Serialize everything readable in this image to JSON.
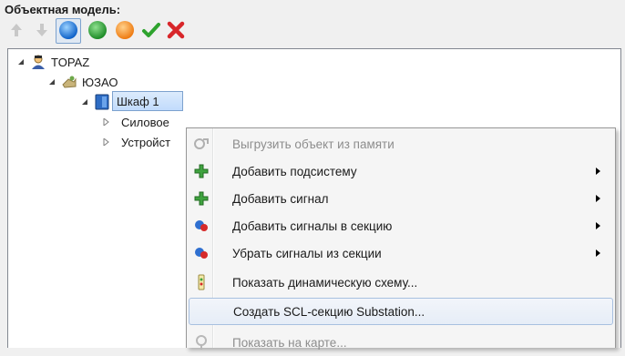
{
  "panel": {
    "title": "Объектная модель:"
  },
  "toolbar": {
    "buttons": [
      {
        "icon": "arrow-up-icon",
        "enabled": false
      },
      {
        "icon": "arrow-down-icon",
        "enabled": false
      },
      {
        "icon": "blue-circle-icon",
        "pressed": true
      },
      {
        "icon": "green-circle-icon"
      },
      {
        "icon": "orange-circle-icon"
      },
      {
        "icon": "checkmark-icon"
      },
      {
        "icon": "red-x-icon"
      }
    ]
  },
  "tree": {
    "nodes": [
      {
        "label": "TOPAZ",
        "icon": "user-icon",
        "expanded": true
      },
      {
        "label": "ЮЗАО",
        "icon": "substation-icon",
        "expanded": true
      },
      {
        "label": "Шкаф 1",
        "icon": "cabinet-icon",
        "expanded": true,
        "selected": true
      },
      {
        "label": "Силовое",
        "expanded": false
      },
      {
        "label": "Устройст",
        "expanded": false
      }
    ]
  },
  "context_menu": {
    "items": [
      {
        "label": "Выгрузить объект из памяти",
        "icon": "unload-icon",
        "disabled": true,
        "submenu": false
      },
      {
        "label": "Добавить подсистему",
        "icon": "green-plus-icon",
        "submenu": true
      },
      {
        "label": "Добавить сигнал",
        "icon": "green-plus-icon",
        "submenu": true
      },
      {
        "label": "Добавить сигналы в секцию",
        "icon": "signals-add-icon",
        "submenu": true
      },
      {
        "label": "Убрать сигналы из секции",
        "icon": "signals-remove-icon",
        "submenu": true
      },
      {
        "label": "Показать динамическую схему...",
        "icon": "scheme-icon",
        "submenu": false
      },
      {
        "label": "Создать SCL-секцию Substation...",
        "icon": "",
        "submenu": false,
        "hover": true
      },
      {
        "label": "Показать на карте...",
        "icon": "map-icon",
        "disabled": true,
        "submenu": false
      }
    ]
  }
}
